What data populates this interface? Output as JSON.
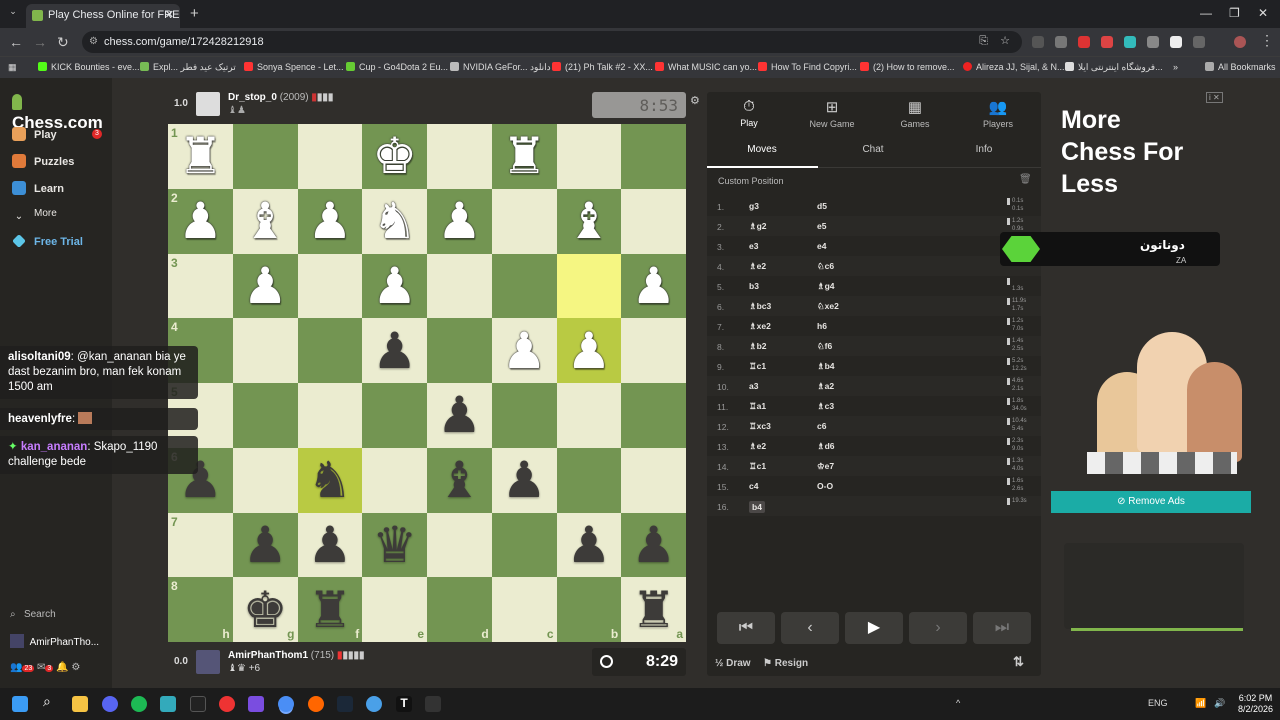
{
  "browser": {
    "tab_title": "Play Chess Online for FREE - 2 P",
    "url": "chess.com/game/172428212918",
    "bookmarks": [
      "KICK Bounties - eve...",
      "Expl... ترتیک عید فطر",
      "Sonya Spence - Let...",
      "Cup - Go4Dota 2 Eu...",
      "NVIDIA GeFor... دانلود",
      "(21) Ph Talk #2 - XX...",
      "What MUSIC can yo...",
      "How To Find Copyri...",
      "(2) How to remove...",
      "Alireza JJ, Sijal, & N...",
      "فروشگاه اینترنتی ایلا...",
      "All Bookmarks"
    ]
  },
  "sidebar": {
    "logo": "Chess.com",
    "items": [
      {
        "label": "Play",
        "icon": "play-hand-icon",
        "badge": "3"
      },
      {
        "label": "Puzzles",
        "icon": "puzzle-icon"
      },
      {
        "label": "Learn",
        "icon": "learn-icon"
      },
      {
        "label": "More",
        "icon": "chevron-down-icon"
      },
      {
        "label": "Free Trial",
        "icon": "diamond-icon"
      }
    ],
    "search": "Search",
    "username": "AmirPhanTho...",
    "notif_badges": [
      "23",
      "3"
    ]
  },
  "chat": [
    {
      "user": "alisoltani09",
      "text": "@kan_ananan bia ye dast bezanim bro, man fek konam 1500 am"
    },
    {
      "user": "heavenlyfre",
      "text": ""
    },
    {
      "user": "kan_ananan",
      "text": "Skapo_1190 challenge bede"
    }
  ],
  "top_player": {
    "score": "1.0",
    "name": "Dr_stop_0",
    "rating": "(2009)",
    "clock": "8:53"
  },
  "bottom_player": {
    "score": "0.0",
    "name": "AmirPhanThom1",
    "rating": "(715)",
    "captured": "+6",
    "clock": "8:29"
  },
  "board": {
    "ranks": [
      "1",
      "2",
      "3",
      "4",
      "5",
      "6",
      "7",
      "8"
    ],
    "files": [
      "h",
      "g",
      "f",
      "e",
      "d",
      "c",
      "b",
      "a"
    ],
    "rows": [
      [
        "wR",
        "",
        "",
        "wK",
        "",
        "wR",
        "",
        ""
      ],
      [
        "wP",
        "wB",
        "wP",
        "wN",
        "wP",
        "",
        "wB",
        ""
      ],
      [
        "",
        "wP",
        "",
        "wP",
        "",
        "",
        "",
        "wP"
      ],
      [
        "",
        "",
        "",
        "bP",
        "",
        "wP",
        "wP",
        ""
      ],
      [
        "",
        "",
        "",
        "",
        "bP",
        "",
        "",
        ""
      ],
      [
        "bP",
        "",
        "bN",
        "",
        "bB",
        "bP",
        "",
        ""
      ],
      [
        "",
        "bP",
        "bP",
        "bQ",
        "",
        "",
        "bP",
        "bP"
      ],
      [
        "",
        "bK",
        "bR",
        "",
        "",
        "",
        "",
        "bR"
      ]
    ],
    "highlights": [
      [
        2,
        6
      ],
      [
        3,
        6
      ],
      [
        5,
        2
      ]
    ]
  },
  "panel": {
    "top_tabs": [
      {
        "label": "Play",
        "icon": "stopwatch-icon"
      },
      {
        "label": "New Game",
        "icon": "plus-icon"
      },
      {
        "label": "Games",
        "icon": "board-icon"
      },
      {
        "label": "Players",
        "icon": "players-icon"
      }
    ],
    "sub_tabs": [
      "Moves",
      "Chat",
      "Info"
    ],
    "custom_position": "Custom Position",
    "moves": [
      {
        "n": "1.",
        "w": "g3",
        "b": "d5",
        "tw": "0.1s",
        "tb": "0.1s"
      },
      {
        "n": "2.",
        "w": "♗g2",
        "b": "e5",
        "tw": "1.2s",
        "tb": "0.9s"
      },
      {
        "n": "3.",
        "w": "e3",
        "b": "e4",
        "tw": "",
        "tb": ""
      },
      {
        "n": "4.",
        "w": "♗e2",
        "b": "♘c6",
        "tw": "",
        "tb": ""
      },
      {
        "n": "5.",
        "w": "b3",
        "b": "♗g4",
        "tw": "",
        "tb": "1.3s"
      },
      {
        "n": "6.",
        "w": "♗bc3",
        "b": "♘xe2",
        "tw": "11.9s",
        "tb": "1.7s"
      },
      {
        "n": "7.",
        "w": "♗xe2",
        "b": "h6",
        "tw": "1.2s",
        "tb": "7.0s"
      },
      {
        "n": "8.",
        "w": "♗b2",
        "b": "♘f6",
        "tw": "1.4s",
        "tb": "2.5s"
      },
      {
        "n": "9.",
        "w": "♖c1",
        "b": "♗b4",
        "tw": "5.2s",
        "tb": "12.2s"
      },
      {
        "n": "10.",
        "w": "a3",
        "b": "♗a2",
        "tw": "4.6s",
        "tb": "2.1s"
      },
      {
        "n": "11.",
        "w": "♖a1",
        "b": "♗c3",
        "tw": "1.8s",
        "tb": "34.0s"
      },
      {
        "n": "12.",
        "w": "♖xc3",
        "b": "c6",
        "tw": "10.4s",
        "tb": "5.4s"
      },
      {
        "n": "13.",
        "w": "♗e2",
        "b": "♗d6",
        "tw": "2.3s",
        "tb": "9.0s"
      },
      {
        "n": "14.",
        "w": "♖c1",
        "b": "♔e7",
        "tw": "1.3s",
        "tb": "4.0s"
      },
      {
        "n": "15.",
        "w": "c4",
        "b": "O-O",
        "tw": "1.6s",
        "tb": "2.6s"
      },
      {
        "n": "16.",
        "w": "b4",
        "b": "",
        "tw": "19.3s",
        "tb": ""
      }
    ],
    "draw": "Draw",
    "draw_prefix": "½",
    "resign": "Resign"
  },
  "ad": {
    "headline": "More Chess For Less",
    "remove_ads": "Remove Ads",
    "overlay_name": "دوناتون",
    "overlay_sub": "ZA"
  },
  "taskbar": {
    "lang": "ENG",
    "time": "6:02 PM",
    "date": "8/2/2026"
  }
}
